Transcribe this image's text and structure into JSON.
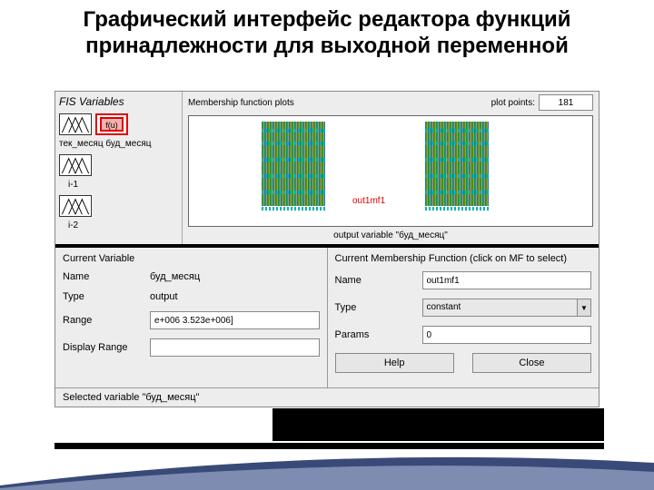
{
  "slide": {
    "title": "Графический интерфейс редактора функций принадлежности для выходной переменной"
  },
  "fis": {
    "title": "FIS Variables",
    "func": "f(u)",
    "vars": [
      {
        "label": "тек_месяц буд_месяц"
      },
      {
        "label": "i-1"
      },
      {
        "label": "i-2"
      }
    ]
  },
  "plot": {
    "header": "Membership function plots",
    "points_label": "plot points:",
    "points_value": "181",
    "mf_label": "out1mf1",
    "caption": "output variable \"буд_месяц\""
  },
  "current_var": {
    "title": "Current Variable",
    "name_lbl": "Name",
    "name_val": "буд_месяц",
    "type_lbl": "Type",
    "type_val": "output",
    "range_lbl": "Range",
    "range_val": "e+006 3.523e+006]",
    "disp_lbl": "Display Range"
  },
  "current_mf": {
    "title": "Current Membership Function (click on MF to select)",
    "name_lbl": "Name",
    "name_val": "out1mf1",
    "type_lbl": "Type",
    "type_val": "constant",
    "params_lbl": "Params",
    "params_val": "0",
    "help": "Help",
    "close": "Close"
  },
  "status": "Selected variable \"буд_месяц\""
}
